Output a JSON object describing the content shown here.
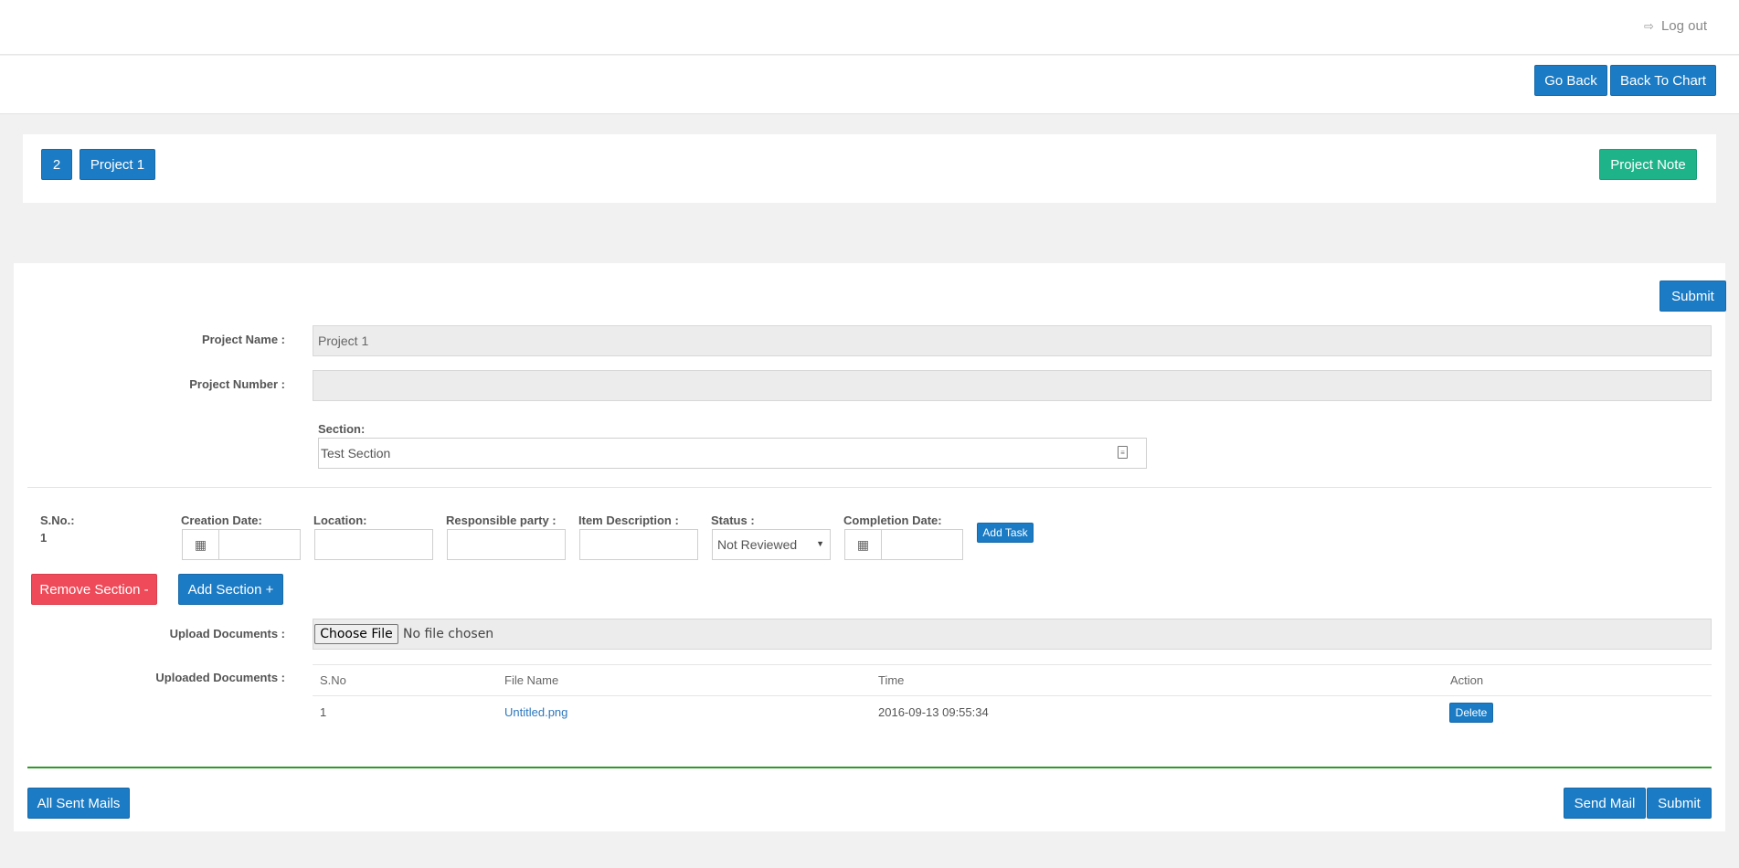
{
  "header": {
    "logout_label": "Log out",
    "logout_icon": "sign-out-icon"
  },
  "toolbar": {
    "go_back_label": "Go Back",
    "back_to_chart_label": "Back To Chart"
  },
  "project_bar": {
    "number_badge": "2",
    "project_button_label": "Project 1",
    "project_note_label": "Project Note"
  },
  "form": {
    "submit_top_label": "Submit",
    "project_name_label": "Project Name :",
    "project_name_value": "Project 1",
    "project_number_label": "Project Number :",
    "project_number_value": "",
    "section_label": "Section:",
    "section_value": "Test Section"
  },
  "task": {
    "sno_label": "S.No.:",
    "sno_value": "1",
    "creation_date_label": "Creation Date:",
    "location_label": "Location:",
    "responsible_party_label": "Responsible party :",
    "item_description_label": "Item Description :",
    "status_label": "Status :",
    "status_value": "Not Reviewed",
    "completion_date_label": "Completion Date:",
    "add_task_label": "Add Task",
    "calendar_icon": "calendar-icon"
  },
  "sections": {
    "remove_section_label": "Remove Section -",
    "add_section_label": "Add Section +"
  },
  "upload": {
    "upload_label": "Upload Documents :",
    "choose_file_label": "Choose File",
    "no_file_text": "No file chosen",
    "uploaded_label": "Uploaded Documents :",
    "columns": [
      "S.No",
      "File Name",
      "Time",
      "Action"
    ],
    "rows": [
      {
        "sno": "1",
        "file_name": "Untitled.png",
        "time": "2016-09-13 09:55:34",
        "action": "Delete"
      }
    ]
  },
  "footer": {
    "all_sent_mails_label": "All Sent Mails",
    "send_mail_label": "Send Mail",
    "submit_label": "Submit"
  },
  "colors": {
    "primary": "#1b7bc4",
    "success": "#1fb38a",
    "danger": "#ee4a59",
    "divider_green": "#2e9a2e"
  }
}
